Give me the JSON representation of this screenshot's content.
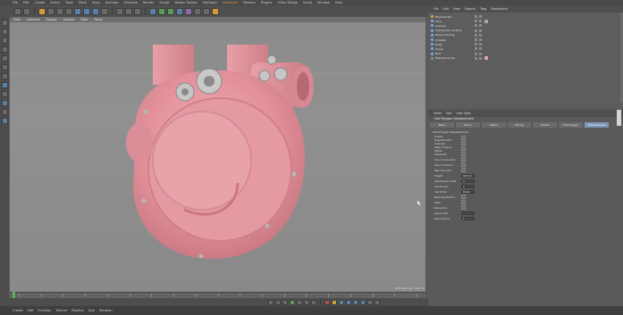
{
  "menubar": {
    "items": [
      "File",
      "Edit",
      "Create",
      "Select",
      "Tools",
      "Mesh",
      "Snap",
      "Animate",
      "Simulate",
      "Render",
      "Sculpt",
      "Motion Tracker",
      "MoGraph",
      "Character",
      "Pipeline",
      "Plugins",
      "V-Ray Bridge",
      "Script",
      "Window",
      "Help"
    ],
    "highlight_index": 13
  },
  "viewport": {
    "menu": [
      "View",
      "Cameras",
      "Display",
      "Options",
      "Filter",
      "Panel"
    ],
    "status": "Grid Spacing : 100 cm"
  },
  "timeline": {
    "frame_marks": [
      "0",
      "5",
      "10",
      "15",
      "20",
      "25",
      "30",
      "35",
      "40",
      "45",
      "50",
      "55",
      "60",
      "65",
      "70",
      "75",
      "80",
      "85",
      "90"
    ],
    "current_frame": "0 F"
  },
  "bottombar": {
    "items": [
      "Create",
      "Edit",
      "Function",
      "Texture",
      "Position",
      "Size",
      "Rotation"
    ]
  },
  "object_manager": {
    "menu": [
      "File",
      "Edit",
      "View",
      "Objects",
      "Tags",
      "Bookmarks"
    ],
    "objects": [
      {
        "name": "Physical Sky",
        "color": "#d8a24a"
      },
      {
        "name": "Floor",
        "color": "#7aa7d8"
      },
      {
        "name": "Camera",
        "color": "#7aa7d8"
      },
      {
        "name": "Subdivision Surface",
        "color": "#7aa7d8"
      },
      {
        "name": "Pump Housing",
        "color": "#7aa7d8"
      },
      {
        "name": "Impeller",
        "color": "#7aa7d8"
      },
      {
        "name": "Bolts",
        "color": "#7aa7d8"
      },
      {
        "name": "Cover",
        "color": "#7aa7d8"
      },
      {
        "name": "Null",
        "color": "#7aa7d8"
      },
      {
        "name": "Material Group",
        "color": "#5ab05a"
      }
    ]
  },
  "attribute_manager": {
    "menu": [
      "Mode",
      "Edit",
      "User Data"
    ],
    "title": "Sub Polygon Displacement",
    "tabs": [
      "Basic",
      "Coord.",
      "Object",
      "Phong",
      "Shader",
      "Sub Polygon",
      "Displacement"
    ],
    "active_tab": 6,
    "section": "Sub Polygon Displacement",
    "rows": [
      {
        "label": "Enable Displacement",
        "type": "check"
      },
      {
        "label": "Intensity",
        "type": "check"
      },
      {
        "label": "Keep Original Edges",
        "type": "check"
      },
      {
        "label": "Distribute",
        "type": "check"
      },
      {
        "label": "Round Geometry",
        "type": "check"
      },
      {
        "label": "Round Contour",
        "type": "check"
      },
      {
        "label": "Map Rounded",
        "type": "check"
      },
      {
        "label": "Height",
        "type": "field",
        "value": "100 cm"
      },
      {
        "label": "Subdivision Level",
        "type": "field",
        "value": "4"
      },
      {
        "label": "Subdivision",
        "type": "field",
        "value": "2"
      },
      {
        "label": "Sub Mode",
        "type": "field",
        "value": "Mode"
      },
      {
        "label": "Best Distribution",
        "type": "check"
      },
      {
        "label": "Keep",
        "type": "check"
      },
      {
        "label": "Resolution",
        "type": "check"
      },
      {
        "label": "Ignore Cell",
        "type": "field",
        "value": ""
      },
      {
        "label": "Base Subdiv",
        "type": "field",
        "value": "1"
      }
    ]
  },
  "colors": {
    "model_pink": "#e79aa2",
    "accent_orange": "#d49a3a",
    "active_tab_blue": "#7d97b8"
  }
}
